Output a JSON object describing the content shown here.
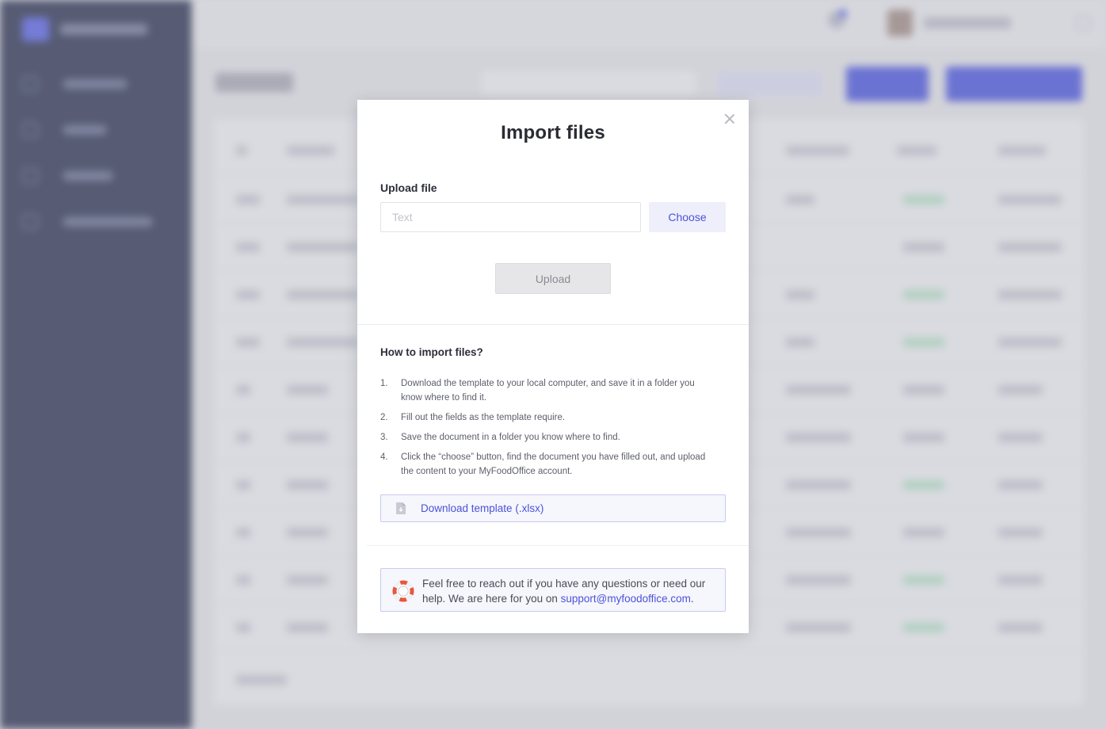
{
  "modal": {
    "title": "Import files",
    "upload_label": "Upload file",
    "file_input_placeholder": "Text",
    "choose_label": "Choose",
    "upload_label_btn": "Upload",
    "howto_title": "How to import files?",
    "steps": [
      {
        "num": "1.",
        "text": "Download the template to your local computer, and save it in a folder you know where to find it."
      },
      {
        "num": "2.",
        "text": "Fill out the fields as the template require."
      },
      {
        "num": "3.",
        "text": "Save the document in a folder you know where to find."
      },
      {
        "num": "4.",
        "text": "Click the “choose” button, find the document you have filled out, and upload the content to your MyFoodOffice account."
      }
    ],
    "download_label": "Download template (.xlsx)",
    "help_text": "Feel free to reach out if you have any questions or need our help. We are here for you on ",
    "help_email": "support@myfoodoffice.com",
    "help_suffix": "."
  },
  "colors": {
    "accent": "#4b52d8",
    "sidebar": "#2b3150",
    "modal_bg": "#ffffff"
  },
  "icons": {
    "close": "close-icon",
    "download": "document-icon",
    "help": "lifebuoy-icon"
  }
}
